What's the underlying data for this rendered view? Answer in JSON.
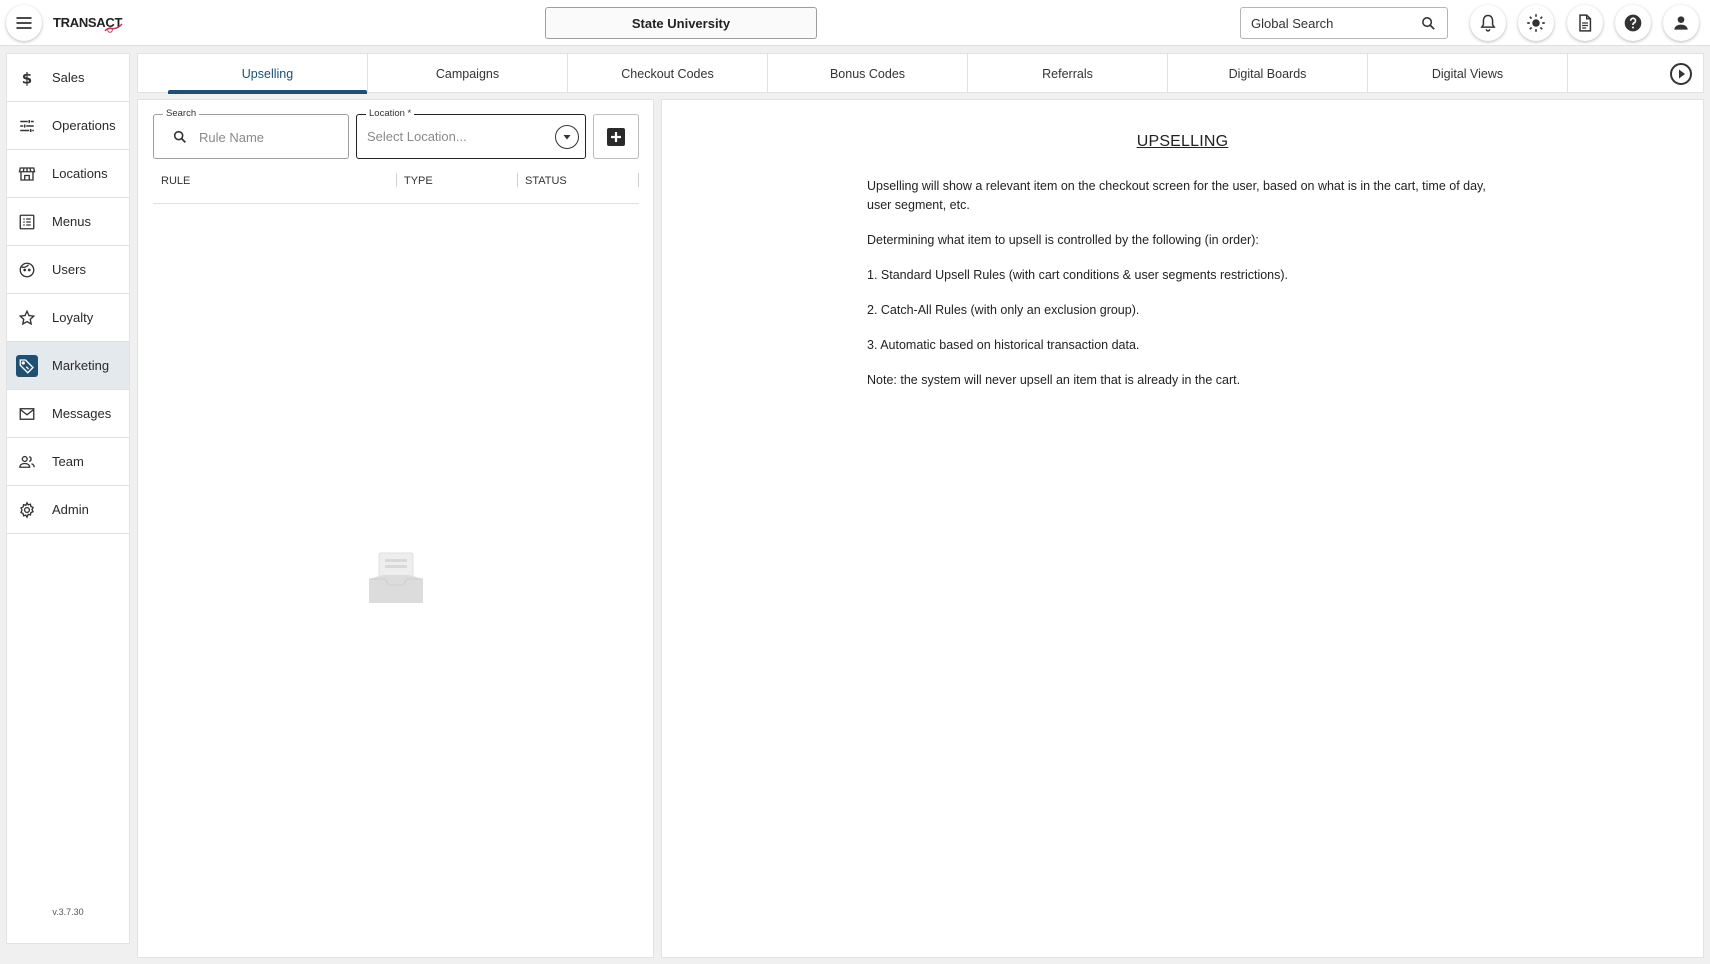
{
  "header": {
    "logo_text": "TRANSACT",
    "org_name": "State University",
    "global_search_placeholder": "Global Search"
  },
  "sidebar": {
    "items": [
      {
        "label": "Sales",
        "icon": "dollar-icon"
      },
      {
        "label": "Operations",
        "icon": "sliders-icon"
      },
      {
        "label": "Locations",
        "icon": "store-icon"
      },
      {
        "label": "Menus",
        "icon": "list-icon"
      },
      {
        "label": "Users",
        "icon": "face-icon"
      },
      {
        "label": "Loyalty",
        "icon": "star-icon"
      },
      {
        "label": "Marketing",
        "icon": "tag-icon",
        "active": true
      },
      {
        "label": "Messages",
        "icon": "mail-icon"
      },
      {
        "label": "Team",
        "icon": "group-icon"
      },
      {
        "label": "Admin",
        "icon": "gear-icon"
      }
    ],
    "version": "v.3.7.30"
  },
  "tabs": [
    "Upselling",
    "Campaigns",
    "Checkout Codes",
    "Bonus Codes",
    "Referrals",
    "Digital Boards",
    "Digital Views"
  ],
  "active_tab": "Upselling",
  "filters": {
    "search_label": "Search",
    "search_placeholder": "Rule Name",
    "location_label": "Location *",
    "location_placeholder": "Select Location..."
  },
  "table": {
    "columns": [
      "RULE",
      "TYPE",
      "STATUS"
    ],
    "rows": []
  },
  "info": {
    "title": "UPSELLING",
    "paragraphs": [
      "Upselling will show a relevant item on the checkout screen for the user, based on what is in the cart, time of day, user segment, etc.",
      "Determining what item to upsell is controlled by the following (in order):",
      "1. Standard Upsell Rules (with cart conditions & user segments restrictions).",
      "2. Catch-All Rules (with only an exclusion group).",
      "3. Automatic based on historical transaction data.",
      "Note: the system will never upsell an item that is already in the cart."
    ]
  },
  "colors": {
    "accent": "#1f4f73",
    "active_nav_bg": "#e4e9ee"
  }
}
